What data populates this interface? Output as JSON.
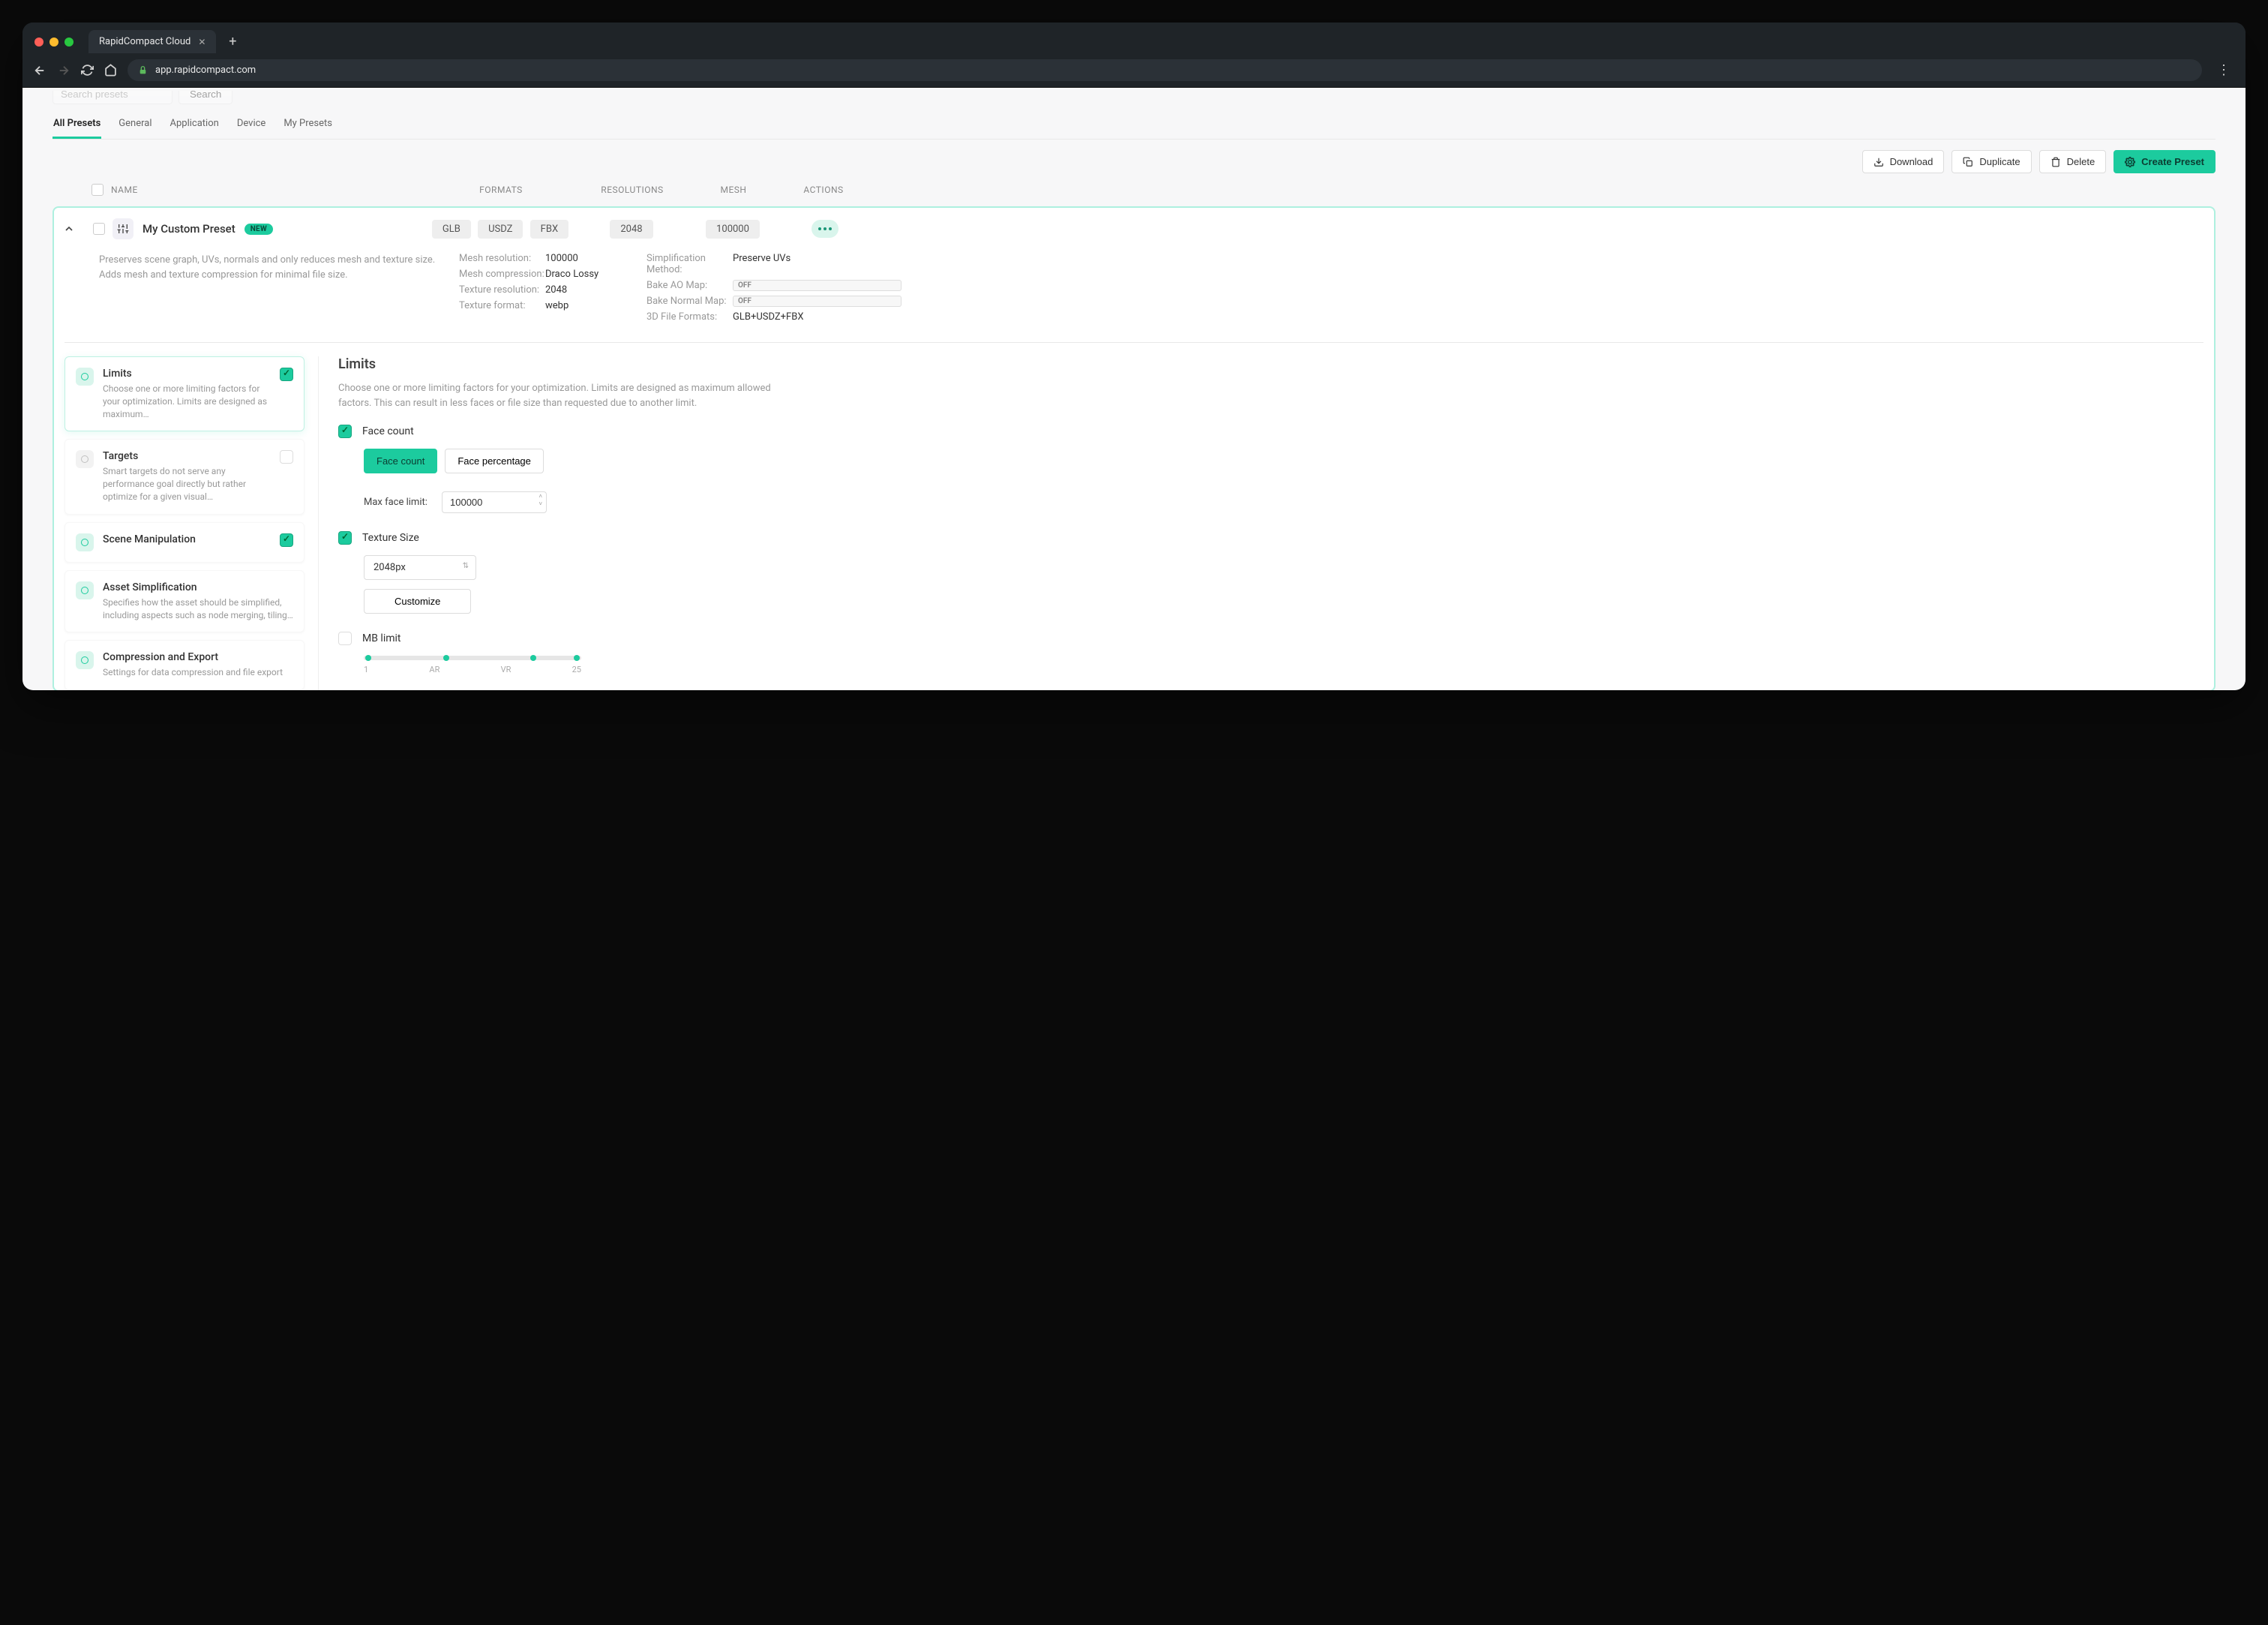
{
  "browser": {
    "tab_title": "RapidCompact Cloud",
    "url": "app.rapidcompact.com"
  },
  "top": {
    "search_placeholder": "Search presets",
    "search_button": "Search"
  },
  "tabs": {
    "all": "All Presets",
    "general": "General",
    "application": "Application",
    "device": "Device",
    "my": "My Presets"
  },
  "actions": {
    "download": "Download",
    "duplicate": "Duplicate",
    "delete": "Delete",
    "create": "Create Preset"
  },
  "table": {
    "name": "NAME",
    "formats": "FORMATS",
    "resolutions": "RESOLUTIONS",
    "mesh": "MESH",
    "actions": "ACTIONS"
  },
  "preset": {
    "name": "My Custom Preset",
    "badge": "NEW",
    "formats": {
      "glb": "GLB",
      "usdz": "USDZ",
      "fbx": "FBX"
    },
    "resolution": "2048",
    "mesh": "100000",
    "description": "Preserves scene graph, UVs, normals and only reduces mesh and texture size. Adds mesh and texture compression for minimal file size.",
    "details_left": {
      "mesh_resolution": {
        "label": "Mesh resolution:",
        "value": "100000"
      },
      "mesh_compression": {
        "label": "Mesh compression:",
        "value": "Draco Lossy"
      },
      "texture_resolution": {
        "label": "Texture resolution:",
        "value": "2048"
      },
      "texture_format": {
        "label": "Texture format:",
        "value": "webp"
      }
    },
    "details_right": {
      "simplification": {
        "label": "Simplification Method:",
        "value": "Preserve UVs"
      },
      "bake_ao": {
        "label": "Bake AO Map:",
        "value": "OFF"
      },
      "bake_normal": {
        "label": "Bake Normal Map:",
        "value": "OFF"
      },
      "file_formats": {
        "label": "3D File Formats:",
        "value": "GLB+USDZ+FBX"
      }
    }
  },
  "steps": {
    "limits": {
      "title": "Limits",
      "desc": "Choose one or more limiting factors for your optimization. Limits are designed as maximum…"
    },
    "targets": {
      "title": "Targets",
      "desc": "Smart targets do not serve any performance goal directly but rather optimize for a given visual…"
    },
    "scene": {
      "title": "Scene Manipulation",
      "desc": ""
    },
    "asset": {
      "title": "Asset Simplification",
      "desc": "Specifies how the asset should be simplified, including aspects such as node merging, tiling…"
    },
    "compression": {
      "title": "Compression and Export",
      "desc": "Settings for data compression and file export"
    }
  },
  "panel": {
    "title": "Limits",
    "description": "Choose one or more limiting factors for your optimization. Limits are designed as maximum allowed factors. This can result in less faces or file size than requested due to another limit.",
    "faceCount": {
      "label": "Face count",
      "tab_count": "Face count",
      "tab_percentage": "Face percentage",
      "max_label": "Max face limit:",
      "max_value": "100000"
    },
    "textureSize": {
      "label": "Texture Size",
      "value": "2048px",
      "customize": "Customize"
    },
    "mb": {
      "label": "MB limit",
      "t1": "1",
      "t2": "AR",
      "t3": "VR",
      "t4": "25"
    }
  }
}
